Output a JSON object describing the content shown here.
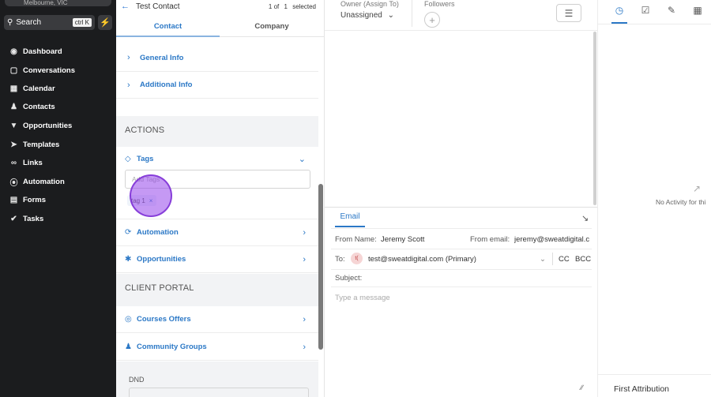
{
  "sidebar": {
    "location": "Melbourne, VIC",
    "search_label": "Search",
    "search_shortcut": "ctrl K",
    "items": [
      {
        "label": "Dashboard",
        "icon": "dashboard-icon"
      },
      {
        "label": "Conversations",
        "icon": "chat-icon"
      },
      {
        "label": "Calendar",
        "icon": "calendar-icon"
      },
      {
        "label": "Contacts",
        "icon": "person-icon"
      },
      {
        "label": "Opportunities",
        "icon": "funnel-icon"
      },
      {
        "label": "Templates",
        "icon": "send-icon"
      },
      {
        "label": "Links",
        "icon": "link-icon"
      },
      {
        "label": "Automation",
        "icon": "automation-icon"
      },
      {
        "label": "Forms",
        "icon": "form-icon"
      },
      {
        "label": "Tasks",
        "icon": "check-circle-icon"
      }
    ]
  },
  "contact_panel": {
    "title": "Test Contact",
    "pager": {
      "current": "1",
      "of_label": "of",
      "total": "1",
      "selected_label": "selected"
    },
    "tabs": [
      "Contact",
      "Company"
    ],
    "sections": [
      "General Info",
      "Additional Info"
    ],
    "actions_header": "ACTIONS",
    "tags_label": "Tags",
    "tags_placeholder": "Add Tags",
    "tags": [
      "tag 1"
    ],
    "action_rows": [
      "Automation",
      "Opportunities"
    ],
    "client_portal_header": "CLIENT PORTAL",
    "portal_rows": [
      "Courses Offers",
      "Community Groups"
    ],
    "dnd_label": "DND"
  },
  "conversation": {
    "owner_label": "Owner (Assign To)",
    "owner_value": "Unassigned",
    "followers_label": "Followers",
    "composer": {
      "tab": "Email",
      "from_name_label": "From Name:",
      "from_name": "Jeremy Scott",
      "from_email_label": "From email:",
      "from_email": "jeremy@sweatdigital.c",
      "to_label": "To:",
      "to_avatar": "t(",
      "to_value": "test@sweatdigital.com (Primary)",
      "cc": "CC",
      "bcc": "BCC",
      "subject_label": "Subject:",
      "message_placeholder": "Type a message"
    }
  },
  "right_panel": {
    "tabs": [
      "clock-icon",
      "checkbox-icon",
      "pen-icon",
      "calendar-icon"
    ],
    "empty_text": "No Activity for thi",
    "footer": "First Attribution"
  },
  "colors": {
    "accent": "#2b78c6",
    "sidebar_bg": "#1b1c1e",
    "click_ring": "#9646eb"
  }
}
